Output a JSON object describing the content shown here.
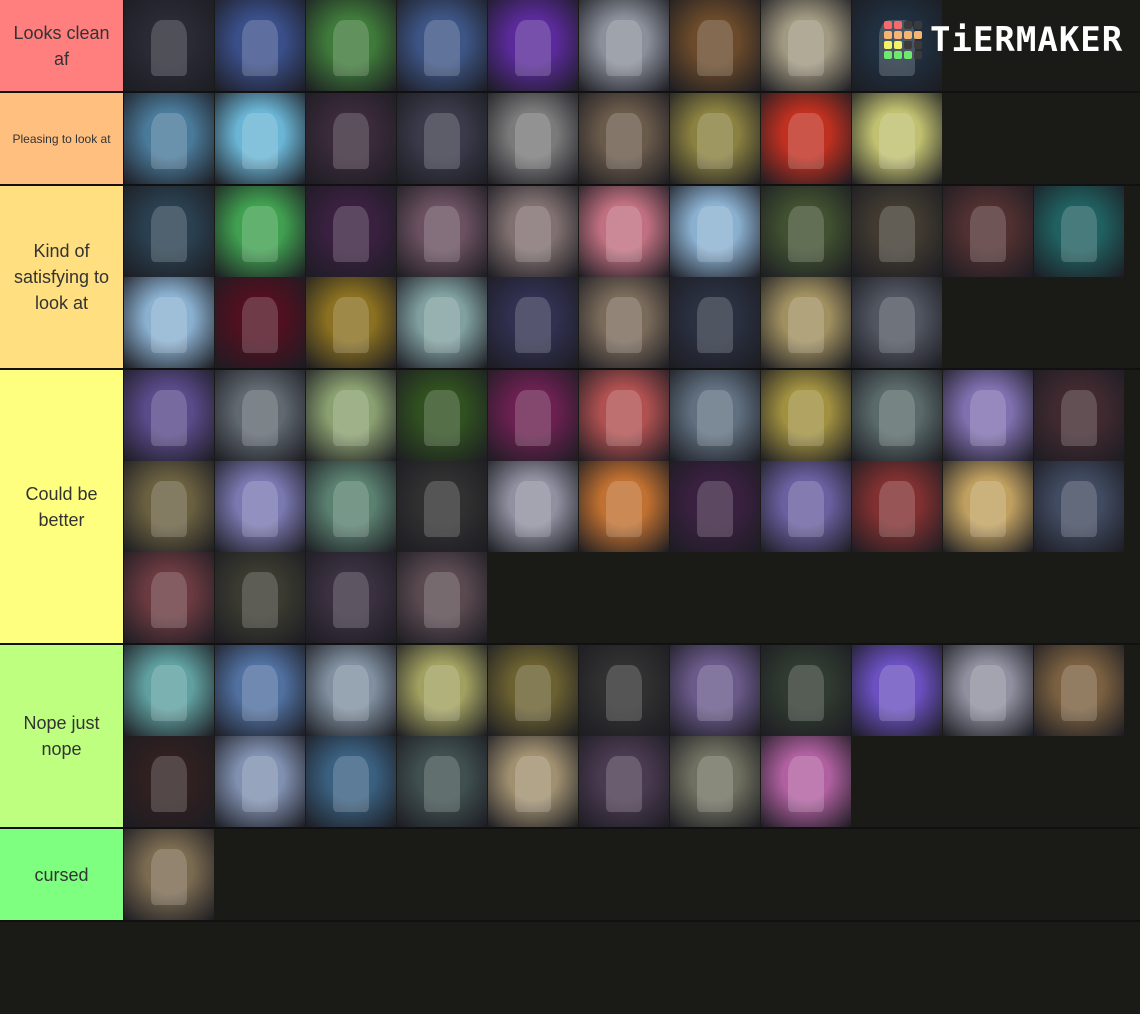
{
  "logo": {
    "text": "TiERMAKER",
    "grid": [
      "#f56b6b",
      "#f56b6b",
      "#3a3a3a",
      "#3a3a3a",
      "#f7b574",
      "#f7b574",
      "#f7b574",
      "#f7b574",
      "#f3f36a",
      "#f3f36a",
      "#3a3a3a",
      "#3a3a3a",
      "#6ee96e",
      "#6ee96e",
      "#6ee96e",
      "#3a3a3a"
    ]
  },
  "tiers": [
    {
      "label": "Looks clean af",
      "color": "#ff7f7f",
      "items": [
        "#2a2a35",
        "#3a4f8a",
        "#3f7a3a",
        "#3d5585",
        "#5a2a9a",
        "#8a8f9a",
        "#6a4a2a",
        "#a09880",
        "#203040"
      ]
    },
    {
      "label": "Pleasing to look at",
      "color": "#ffbf7f",
      "items": [
        "#4a7a9a",
        "#6ab5d5",
        "#3a2a3a",
        "#3a3a4a",
        "#7a7a7a",
        "#6a5a4a",
        "#8a8040",
        "#c03020",
        "#c0c070"
      ]
    },
    {
      "label": "Kind of satisfying to look at",
      "color": "#ffdf7f",
      "items": [
        "#2a4050",
        "#40a050",
        "#3a2040",
        "#6a5060",
        "#807070",
        "#c07080",
        "#8ab0d0",
        "#405030",
        "#403a30",
        "#503030",
        "#206060",
        "#8ab0d0",
        "#501020",
        "#8a7020",
        "#80a0a0",
        "#303050",
        "#7a6a5a",
        "#2a3040",
        "#a09060",
        "#505560"
      ]
    },
    {
      "label": "Could be better",
      "color": "#ffff7f",
      "items": [
        "#5a4a8a",
        "#606870",
        "#8aa070",
        "#305020",
        "#6a2050",
        "#b05050",
        "#607080",
        "#a09040",
        "#5a6a6a",
        "#8070b0",
        "#402a30",
        "#6a6040",
        "#7a78b0",
        "#5a8070",
        "#303030",
        "#9090a0",
        "#c07030",
        "#3a2040",
        "#6a60a0",
        "#803030",
        "#c0a060",
        "#404a60",
        "#6a3a40",
        "#3a3a30",
        "#3a3040",
        "#5a4a50"
      ]
    },
    {
      "label": "Nope just nope",
      "color": "#bfff7f",
      "items": [
        "#60a0a0",
        "#5070a0",
        "#8090a0",
        "#a0a060",
        "#6a6030",
        "#303030",
        "#6a5a8a",
        "#303a30",
        "#6a50c0",
        "#9090a0",
        "#7a6040",
        "#302020",
        "#8090b0",
        "#3a6080",
        "#405050",
        "#a09070",
        "#4a3a50",
        "#707060",
        "#b060a0"
      ]
    },
    {
      "label": "cursed",
      "color": "#7fff7f",
      "items": [
        "#7a6a50"
      ]
    }
  ]
}
